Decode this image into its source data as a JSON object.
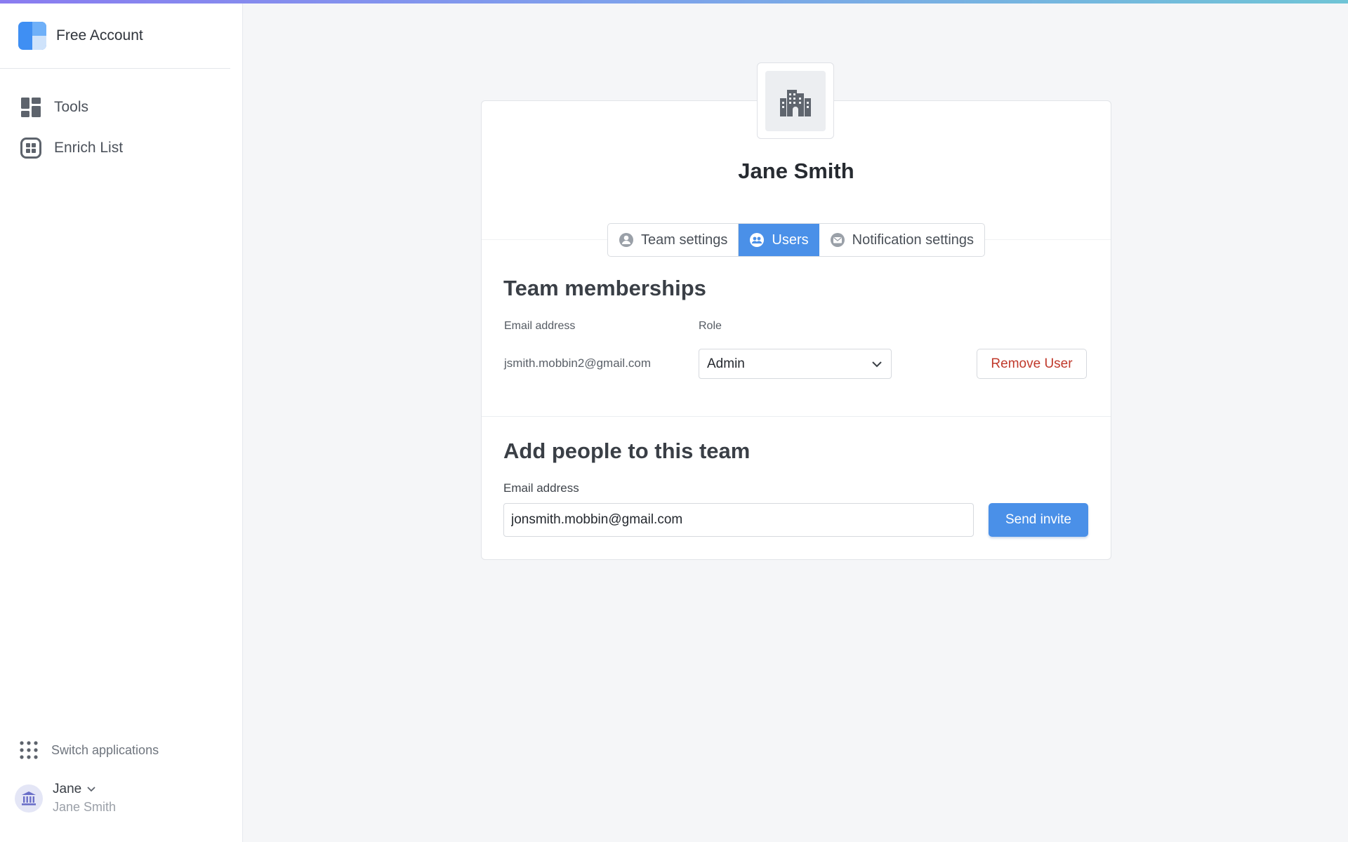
{
  "brand": {
    "name": "Free Account"
  },
  "nav": {
    "items": [
      {
        "label": "Tools",
        "icon": "dashboard-icon"
      },
      {
        "label": "Enrich List",
        "icon": "grid-icon"
      }
    ]
  },
  "footer": {
    "switch_apps_label": "Switch applications",
    "user_first_name": "Jane",
    "user_full_name": "Jane Smith"
  },
  "team": {
    "name": "Jane Smith",
    "logo_icon": "building-icon"
  },
  "tabs": [
    {
      "label": "Team settings",
      "icon": "person-icon",
      "active": false
    },
    {
      "label": "Users",
      "icon": "users-icon",
      "active": true
    },
    {
      "label": "Notification settings",
      "icon": "mail-icon",
      "active": false
    }
  ],
  "memberships": {
    "title": "Team memberships",
    "email_header": "Email address",
    "role_header": "Role",
    "rows": [
      {
        "email": "jsmith.mobbin2@gmail.com",
        "role": "Admin",
        "remove_label": "Remove User"
      }
    ]
  },
  "add_people": {
    "title": "Add people to this team",
    "email_label": "Email address",
    "email_value": "jonsmith.mobbin@gmail.com",
    "send_label": "Send invite"
  },
  "colors": {
    "accent": "#4a90e8",
    "danger": "#c0392b",
    "background": "#f5f6f8"
  }
}
